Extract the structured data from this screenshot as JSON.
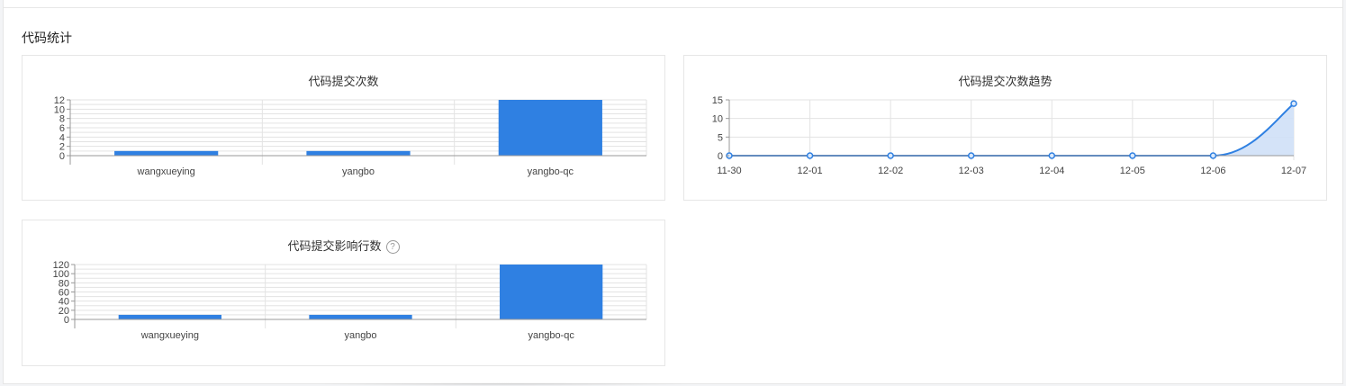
{
  "section_title": "代码统计",
  "colors": {
    "bar": "#2f80e2",
    "line": "#2f80e2",
    "area": "#cfe0f7",
    "grid": "#e3e3e3",
    "axis": "#999999"
  },
  "icons": {
    "help": "?"
  },
  "chart_data": [
    {
      "type": "bar",
      "title": "代码提交次数",
      "categories": [
        "wangxueying",
        "yangbo",
        "yangbo-qc"
      ],
      "values": [
        1,
        1,
        12
      ],
      "ylim": [
        0,
        12
      ],
      "yticks": [
        0,
        2,
        4,
        6,
        8,
        10,
        12
      ],
      "grid": true
    },
    {
      "type": "area",
      "title": "代码提交次数趋势",
      "x": [
        "11-30",
        "12-01",
        "12-02",
        "12-03",
        "12-04",
        "12-05",
        "12-06",
        "12-07"
      ],
      "values": [
        0,
        0,
        0,
        0,
        0,
        0,
        0,
        14
      ],
      "ylim": [
        0,
        15
      ],
      "yticks": [
        0,
        5,
        10,
        15
      ],
      "grid": true
    },
    {
      "type": "bar",
      "title": "代码提交影响行数",
      "categories": [
        "wangxueying",
        "yangbo",
        "yangbo-qc"
      ],
      "values": [
        10,
        10,
        120
      ],
      "ylim": [
        0,
        120
      ],
      "yticks": [
        0,
        20,
        40,
        60,
        80,
        100,
        120
      ],
      "grid": true
    }
  ]
}
